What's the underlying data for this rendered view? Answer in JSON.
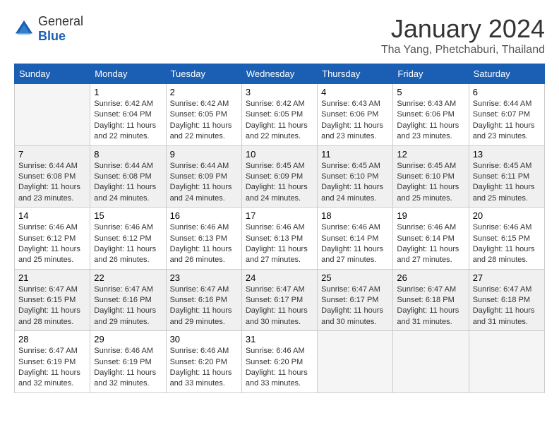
{
  "header": {
    "logo_general": "General",
    "logo_blue": "Blue",
    "title": "January 2024",
    "location": "Tha Yang, Phetchaburi, Thailand"
  },
  "days_of_week": [
    "Sunday",
    "Monday",
    "Tuesday",
    "Wednesday",
    "Thursday",
    "Friday",
    "Saturday"
  ],
  "weeks": [
    [
      {
        "day": "",
        "sunrise": "",
        "sunset": "",
        "daylight": "",
        "empty": true
      },
      {
        "day": "1",
        "sunrise": "Sunrise: 6:42 AM",
        "sunset": "Sunset: 6:04 PM",
        "daylight": "Daylight: 11 hours and 22 minutes."
      },
      {
        "day": "2",
        "sunrise": "Sunrise: 6:42 AM",
        "sunset": "Sunset: 6:05 PM",
        "daylight": "Daylight: 11 hours and 22 minutes."
      },
      {
        "day": "3",
        "sunrise": "Sunrise: 6:42 AM",
        "sunset": "Sunset: 6:05 PM",
        "daylight": "Daylight: 11 hours and 22 minutes."
      },
      {
        "day": "4",
        "sunrise": "Sunrise: 6:43 AM",
        "sunset": "Sunset: 6:06 PM",
        "daylight": "Daylight: 11 hours and 23 minutes."
      },
      {
        "day": "5",
        "sunrise": "Sunrise: 6:43 AM",
        "sunset": "Sunset: 6:06 PM",
        "daylight": "Daylight: 11 hours and 23 minutes."
      },
      {
        "day": "6",
        "sunrise": "Sunrise: 6:44 AM",
        "sunset": "Sunset: 6:07 PM",
        "daylight": "Daylight: 11 hours and 23 minutes."
      }
    ],
    [
      {
        "day": "7",
        "sunrise": "Sunrise: 6:44 AM",
        "sunset": "Sunset: 6:08 PM",
        "daylight": "Daylight: 11 hours and 23 minutes."
      },
      {
        "day": "8",
        "sunrise": "Sunrise: 6:44 AM",
        "sunset": "Sunset: 6:08 PM",
        "daylight": "Daylight: 11 hours and 24 minutes."
      },
      {
        "day": "9",
        "sunrise": "Sunrise: 6:44 AM",
        "sunset": "Sunset: 6:09 PM",
        "daylight": "Daylight: 11 hours and 24 minutes."
      },
      {
        "day": "10",
        "sunrise": "Sunrise: 6:45 AM",
        "sunset": "Sunset: 6:09 PM",
        "daylight": "Daylight: 11 hours and 24 minutes."
      },
      {
        "day": "11",
        "sunrise": "Sunrise: 6:45 AM",
        "sunset": "Sunset: 6:10 PM",
        "daylight": "Daylight: 11 hours and 24 minutes."
      },
      {
        "day": "12",
        "sunrise": "Sunrise: 6:45 AM",
        "sunset": "Sunset: 6:10 PM",
        "daylight": "Daylight: 11 hours and 25 minutes."
      },
      {
        "day": "13",
        "sunrise": "Sunrise: 6:45 AM",
        "sunset": "Sunset: 6:11 PM",
        "daylight": "Daylight: 11 hours and 25 minutes."
      }
    ],
    [
      {
        "day": "14",
        "sunrise": "Sunrise: 6:46 AM",
        "sunset": "Sunset: 6:12 PM",
        "daylight": "Daylight: 11 hours and 25 minutes."
      },
      {
        "day": "15",
        "sunrise": "Sunrise: 6:46 AM",
        "sunset": "Sunset: 6:12 PM",
        "daylight": "Daylight: 11 hours and 26 minutes."
      },
      {
        "day": "16",
        "sunrise": "Sunrise: 6:46 AM",
        "sunset": "Sunset: 6:13 PM",
        "daylight": "Daylight: 11 hours and 26 minutes."
      },
      {
        "day": "17",
        "sunrise": "Sunrise: 6:46 AM",
        "sunset": "Sunset: 6:13 PM",
        "daylight": "Daylight: 11 hours and 27 minutes."
      },
      {
        "day": "18",
        "sunrise": "Sunrise: 6:46 AM",
        "sunset": "Sunset: 6:14 PM",
        "daylight": "Daylight: 11 hours and 27 minutes."
      },
      {
        "day": "19",
        "sunrise": "Sunrise: 6:46 AM",
        "sunset": "Sunset: 6:14 PM",
        "daylight": "Daylight: 11 hours and 27 minutes."
      },
      {
        "day": "20",
        "sunrise": "Sunrise: 6:46 AM",
        "sunset": "Sunset: 6:15 PM",
        "daylight": "Daylight: 11 hours and 28 minutes."
      }
    ],
    [
      {
        "day": "21",
        "sunrise": "Sunrise: 6:47 AM",
        "sunset": "Sunset: 6:15 PM",
        "daylight": "Daylight: 11 hours and 28 minutes."
      },
      {
        "day": "22",
        "sunrise": "Sunrise: 6:47 AM",
        "sunset": "Sunset: 6:16 PM",
        "daylight": "Daylight: 11 hours and 29 minutes."
      },
      {
        "day": "23",
        "sunrise": "Sunrise: 6:47 AM",
        "sunset": "Sunset: 6:16 PM",
        "daylight": "Daylight: 11 hours and 29 minutes."
      },
      {
        "day": "24",
        "sunrise": "Sunrise: 6:47 AM",
        "sunset": "Sunset: 6:17 PM",
        "daylight": "Daylight: 11 hours and 30 minutes."
      },
      {
        "day": "25",
        "sunrise": "Sunrise: 6:47 AM",
        "sunset": "Sunset: 6:17 PM",
        "daylight": "Daylight: 11 hours and 30 minutes."
      },
      {
        "day": "26",
        "sunrise": "Sunrise: 6:47 AM",
        "sunset": "Sunset: 6:18 PM",
        "daylight": "Daylight: 11 hours and 31 minutes."
      },
      {
        "day": "27",
        "sunrise": "Sunrise: 6:47 AM",
        "sunset": "Sunset: 6:18 PM",
        "daylight": "Daylight: 11 hours and 31 minutes."
      }
    ],
    [
      {
        "day": "28",
        "sunrise": "Sunrise: 6:47 AM",
        "sunset": "Sunset: 6:19 PM",
        "daylight": "Daylight: 11 hours and 32 minutes."
      },
      {
        "day": "29",
        "sunrise": "Sunrise: 6:46 AM",
        "sunset": "Sunset: 6:19 PM",
        "daylight": "Daylight: 11 hours and 32 minutes."
      },
      {
        "day": "30",
        "sunrise": "Sunrise: 6:46 AM",
        "sunset": "Sunset: 6:20 PM",
        "daylight": "Daylight: 11 hours and 33 minutes."
      },
      {
        "day": "31",
        "sunrise": "Sunrise: 6:46 AM",
        "sunset": "Sunset: 6:20 PM",
        "daylight": "Daylight: 11 hours and 33 minutes."
      },
      {
        "day": "",
        "sunrise": "",
        "sunset": "",
        "daylight": "",
        "empty": true
      },
      {
        "day": "",
        "sunrise": "",
        "sunset": "",
        "daylight": "",
        "empty": true
      },
      {
        "day": "",
        "sunrise": "",
        "sunset": "",
        "daylight": "",
        "empty": true
      }
    ]
  ]
}
